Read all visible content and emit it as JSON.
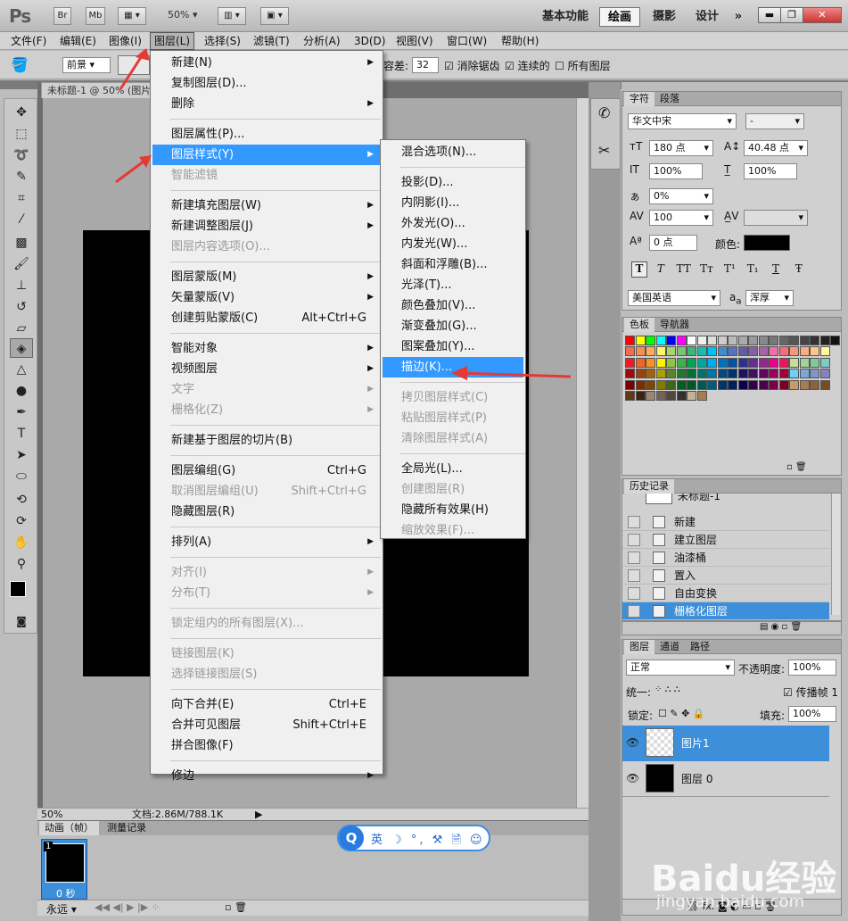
{
  "app": {
    "logo": "Ps",
    "zoom": "50%",
    "btn_br": "Br",
    "btn_mb": "Mb"
  },
  "workspaces": [
    "基本功能",
    "绘画",
    "摄影",
    "设计",
    "»"
  ],
  "active_workspace": "绘画",
  "menubar": [
    "文件(F)",
    "编辑(E)",
    "图像(I)",
    "图层(L)",
    "选择(S)",
    "滤镜(T)",
    "分析(A)",
    "3D(D)",
    "视图(V)",
    "窗口(W)",
    "帮助(H)"
  ],
  "options": {
    "fill_source": "前景",
    "tolerance_label": "容差:",
    "tolerance_value": "32",
    "anti_alias": "消除锯齿",
    "contiguous": "连续的",
    "all_layers": "所有图层"
  },
  "document": {
    "tab_title": "未标题-1 @ 50% (图片",
    "zoom": "50%",
    "doc_size": "文档:2.86M/788.1K"
  },
  "layer_menu": [
    {
      "label": "新建(N)",
      "arrow": true
    },
    {
      "label": "复制图层(D)..."
    },
    {
      "label": "删除",
      "arrow": true
    },
    {
      "sep": true
    },
    {
      "label": "图层属性(P)..."
    },
    {
      "label": "图层样式(Y)",
      "arrow": true,
      "highlight": true
    },
    {
      "label": "智能滤镜",
      "disabled": true
    },
    {
      "sep": true
    },
    {
      "label": "新建填充图层(W)",
      "arrow": true
    },
    {
      "label": "新建调整图层(J)",
      "arrow": true
    },
    {
      "label": "图层内容选项(O)...",
      "disabled": true
    },
    {
      "sep": true
    },
    {
      "label": "图层蒙版(M)",
      "arrow": true
    },
    {
      "label": "矢量蒙版(V)",
      "arrow": true
    },
    {
      "label": "创建剪贴蒙版(C)",
      "shortcut": "Alt+Ctrl+G"
    },
    {
      "sep": true
    },
    {
      "label": "智能对象",
      "arrow": true
    },
    {
      "label": "视频图层",
      "arrow": true
    },
    {
      "label": "文字",
      "arrow": true,
      "disabled": true
    },
    {
      "label": "栅格化(Z)",
      "arrow": true,
      "disabled": true
    },
    {
      "sep": true
    },
    {
      "label": "新建基于图层的切片(B)"
    },
    {
      "sep": true
    },
    {
      "label": "图层编组(G)",
      "shortcut": "Ctrl+G"
    },
    {
      "label": "取消图层编组(U)",
      "shortcut": "Shift+Ctrl+G",
      "disabled": true
    },
    {
      "label": "隐藏图层(R)"
    },
    {
      "sep": true
    },
    {
      "label": "排列(A)",
      "arrow": true
    },
    {
      "sep": true
    },
    {
      "label": "对齐(I)",
      "arrow": true,
      "disabled": true
    },
    {
      "label": "分布(T)",
      "arrow": true,
      "disabled": true
    },
    {
      "sep": true
    },
    {
      "label": "锁定组内的所有图层(X)...",
      "disabled": true
    },
    {
      "sep": true
    },
    {
      "label": "链接图层(K)",
      "disabled": true
    },
    {
      "label": "选择链接图层(S)",
      "disabled": true
    },
    {
      "sep": true
    },
    {
      "label": "向下合并(E)",
      "shortcut": "Ctrl+E"
    },
    {
      "label": "合并可见图层",
      "shortcut": "Shift+Ctrl+E"
    },
    {
      "label": "拼合图像(F)"
    },
    {
      "sep": true
    },
    {
      "label": "修边",
      "arrow": true
    }
  ],
  "style_menu": [
    {
      "label": "混合选项(N)..."
    },
    {
      "sep": true
    },
    {
      "label": "投影(D)..."
    },
    {
      "label": "内阴影(I)..."
    },
    {
      "label": "外发光(O)..."
    },
    {
      "label": "内发光(W)..."
    },
    {
      "label": "斜面和浮雕(B)..."
    },
    {
      "label": "光泽(T)..."
    },
    {
      "label": "颜色叠加(V)..."
    },
    {
      "label": "渐变叠加(G)..."
    },
    {
      "label": "图案叠加(Y)..."
    },
    {
      "label": "描边(K)...",
      "highlight": true
    },
    {
      "sep": true
    },
    {
      "label": "拷贝图层样式(C)",
      "disabled": true
    },
    {
      "label": "粘贴图层样式(P)",
      "disabled": true
    },
    {
      "label": "清除图层样式(A)",
      "disabled": true
    },
    {
      "sep": true
    },
    {
      "label": "全局光(L)..."
    },
    {
      "label": "创建图层(R)",
      "disabled": true
    },
    {
      "label": "隐藏所有效果(H)"
    },
    {
      "label": "缩放效果(F)...",
      "disabled": true
    }
  ],
  "char_panel": {
    "tabs": [
      "字符",
      "段落"
    ],
    "font": "华文中宋",
    "style": "-",
    "size": "180 点",
    "leading": "40.48 点",
    "vscale": "100%",
    "hscale": "100%",
    "tsume": "0%",
    "tracking": "100",
    "baseline": "0 点",
    "color_label": "颜色:",
    "language": "美国英语",
    "aa_prefix": "a",
    "aa_sub": "a",
    "aa": "浑厚",
    "style_buttons": [
      "T",
      "T",
      "TT",
      "Tт",
      "T¹",
      "T₁",
      "T",
      "Ŧ"
    ]
  },
  "swatch_panel": {
    "tabs": [
      "色板",
      "导航器"
    ]
  },
  "history_panel": {
    "tab": "历史记录",
    "snapshot": "未标题-1",
    "items": [
      "新建",
      "建立图层",
      "油漆桶",
      "置入",
      "自由变换",
      "栅格化图层"
    ],
    "selected": "栅格化图层"
  },
  "layers_panel": {
    "tabs": [
      "图层",
      "通道",
      "路径"
    ],
    "blend": "正常",
    "opacity_label": "不透明度:",
    "opacity": "100%",
    "unify": "统一:",
    "propagate": "传播帧 1",
    "lock": "锁定:",
    "fill_label": "填充:",
    "fill": "100%",
    "layers": [
      {
        "name": "图片1",
        "selected": true
      },
      {
        "name": "图层 0"
      }
    ],
    "footer_fx": "fx."
  },
  "animation": {
    "tabs": [
      "动画（帧）",
      "测量记录"
    ],
    "frame_no": "1",
    "frame_time": "0 秒",
    "loop": "永远"
  },
  "ime": {
    "letter": "Q",
    "icons": "英 ☽ °, ⚒ 🗎 ☺",
    "mode": "英"
  },
  "watermark": {
    "brand": "Baidu经验",
    "url": "jingyan.baidu.com"
  },
  "colors": {
    "highlight": "#3399ff",
    "arrow": "#e53935",
    "selected_row": "#3c8fd8"
  }
}
